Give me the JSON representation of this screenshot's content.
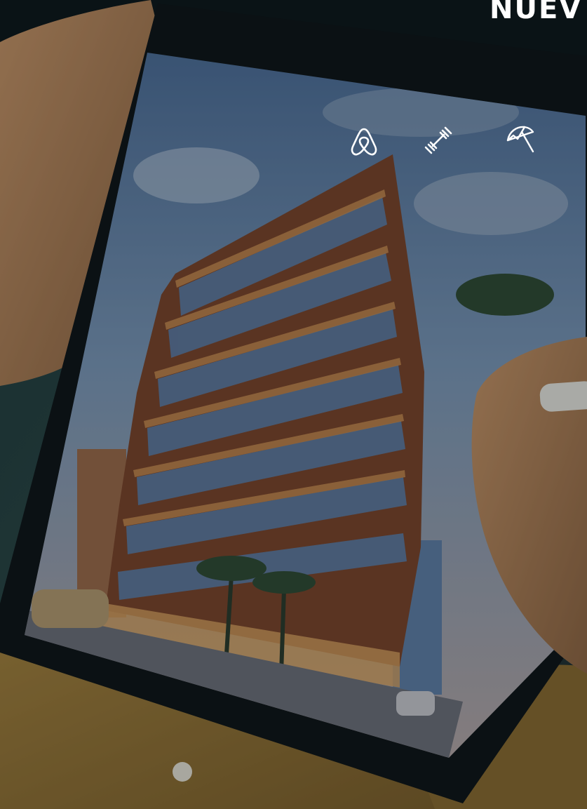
{
  "headline": {
    "text": "NUEV"
  },
  "icons": [
    {
      "name": "airbnb-icon"
    },
    {
      "name": "dumbbell-icon"
    },
    {
      "name": "beach-umbrella-icon"
    }
  ],
  "colors": {
    "tablet_bezel": "#0d1215",
    "sky": "#5d7fa6",
    "facade_wood": "#8a4a2c",
    "facade_glass": "#4e6a8e",
    "sweater": "#9b7a3a",
    "skin": "#b88a5e",
    "icon": "#ffffff"
  }
}
